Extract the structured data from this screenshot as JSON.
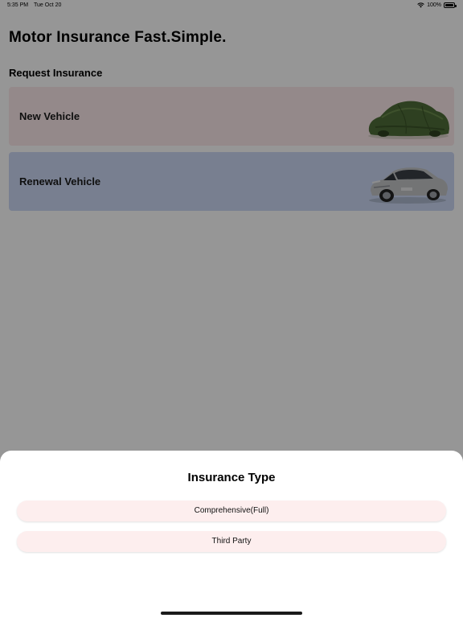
{
  "status_bar": {
    "time": "5:35 PM",
    "date": "Tue Oct 20",
    "battery": "100%"
  },
  "header": {
    "title": "Motor Insurance Fast.Simple."
  },
  "request": {
    "section_title": "Request Insurance",
    "cards": [
      {
        "label": "New Vehicle",
        "color": "#fbe9ea",
        "image": "covered-car-icon"
      },
      {
        "label": "Renewal Vehicle",
        "color": "#cdd9f5",
        "image": "silver-car-icon"
      }
    ]
  },
  "sheet": {
    "title": "Insurance Type",
    "options": [
      "Comprehensive(Full)",
      "Third Party"
    ],
    "option_color": "#fdeeee"
  }
}
